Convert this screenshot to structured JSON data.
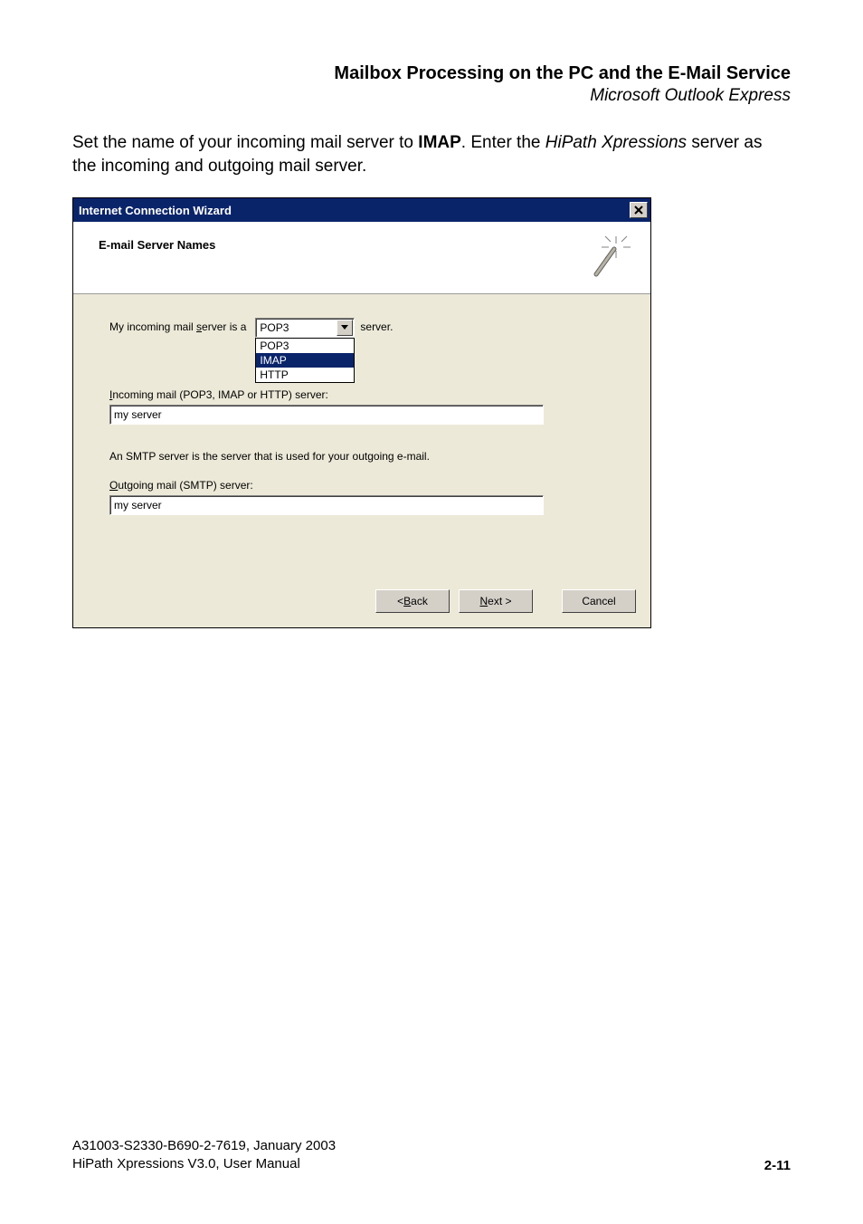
{
  "header": {
    "title": "Mailbox Processing on the PC and the E-Mail Service",
    "subtitle": "Microsoft Outlook Express"
  },
  "intro": {
    "pre": "Set the name of your incoming mail server to ",
    "bold": "IMAP",
    "mid": ". Enter the ",
    "italic": "HiPath Xpressions",
    "post": " server as the incoming and outgoing mail server."
  },
  "dialog": {
    "title": "Internet Connection Wizard",
    "headerTitle": "E-mail Server Names",
    "incoming": {
      "label_pre": "My incoming mail ",
      "label_key": "s",
      "label_post": "erver is a",
      "suffix": "server."
    },
    "combo": {
      "value": "POP3",
      "options": [
        "POP3",
        "IMAP",
        "HTTP"
      ],
      "selectedIndex": 1
    },
    "incomingField": {
      "label_key": "I",
      "label_rest": "ncoming mail (POP3, IMAP or HTTP) server:",
      "value": "my server"
    },
    "smtpNote": "An SMTP server is the server that is used for your outgoing e-mail.",
    "outgoingField": {
      "label_key": "O",
      "label_rest": "utgoing mail (SMTP) server:",
      "value": "my server"
    },
    "buttons": {
      "back_pre": "< ",
      "back_key": "B",
      "back_post": "ack",
      "next_key": "N",
      "next_post": "ext >",
      "cancel": "Cancel"
    }
  },
  "footer": {
    "line1": "A31003-S2330-B690-2-7619, January 2003",
    "line2": "HiPath Xpressions V3.0, User Manual",
    "pageNumber": "2-11"
  }
}
